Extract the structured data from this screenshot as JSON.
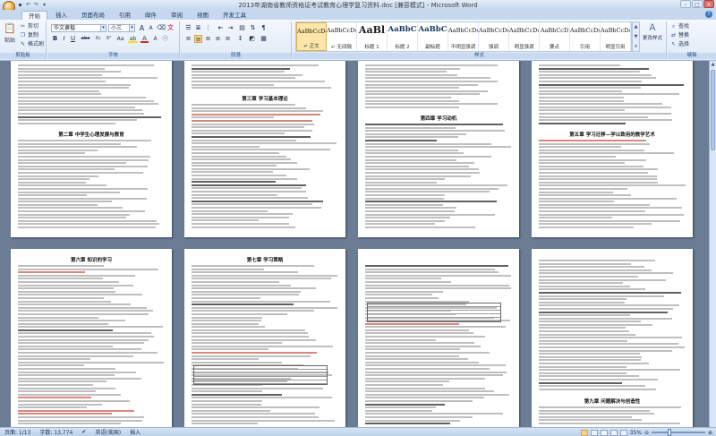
{
  "window": {
    "title": "2013年湖南省教师资格证考试教育心理学复习资料.doc [兼容模式] - Microsoft Word"
  },
  "quick_access": [
    "save-icon",
    "undo-icon",
    "redo-icon",
    "dropdown-icon"
  ],
  "tabs": [
    "开始",
    "插入",
    "页面布局",
    "引用",
    "邮件",
    "审阅",
    "视图",
    "开发工具"
  ],
  "active_tab_index": 0,
  "ribbon": {
    "clipboard": {
      "label": "剪贴板",
      "paste": "粘贴",
      "cut": "剪切",
      "copy": "复制",
      "format_painter": "格式刷"
    },
    "font": {
      "label": "字体",
      "font_name": "华文隶楷",
      "font_size": "小三",
      "grow": "A",
      "shrink": "A",
      "bold": "B",
      "italic": "I",
      "underline": "U",
      "strike": "abc",
      "subscript": "X₂",
      "superscript": "X²",
      "change_case": "Aa",
      "highlight": "ab",
      "font_color": "A"
    },
    "paragraph": {
      "label": "段落"
    },
    "styles": {
      "label": "样式",
      "items": [
        {
          "sample": "AaBbCcDc",
          "name": "↵ 正文",
          "kind": "normal"
        },
        {
          "sample": "AaBbCcDc",
          "name": "↵ 无间隔",
          "kind": "normal"
        },
        {
          "sample": "AaBl",
          "name": "标题 1",
          "kind": "big"
        },
        {
          "sample": "AaBbC",
          "name": "标题 2",
          "kind": "head"
        },
        {
          "sample": "AaBbC",
          "name": "副标题",
          "kind": "head"
        },
        {
          "sample": "AaBbCcDc",
          "name": "不明显强调",
          "kind": "normal"
        },
        {
          "sample": "AaBbCcDc",
          "name": "强调",
          "kind": "normal"
        },
        {
          "sample": "AaBbCcDc",
          "name": "明显强调",
          "kind": "normal"
        },
        {
          "sample": "AaBbCcD",
          "name": "要点",
          "kind": "normal"
        },
        {
          "sample": "AaBbCcDc",
          "name": "引用",
          "kind": "normal"
        },
        {
          "sample": "AaBbCcDc",
          "name": "明显引用",
          "kind": "normal"
        }
      ],
      "change_styles": "更改样式"
    },
    "editing": {
      "label": "编辑",
      "find": "查找",
      "replace": "替换",
      "select": "选择"
    }
  },
  "pages": [
    {
      "heading": "第二章 中学生心理发展与教育"
    },
    {
      "heading": "第三章 学习基本理论"
    },
    {
      "heading": "第四章 学习动机"
    },
    {
      "heading": "第五章 学习迁移—学以致用的教学艺术"
    },
    {
      "heading": "第六章 知识的学习"
    },
    {
      "heading": "第七章 学习策略"
    },
    {
      "heading": ""
    },
    {
      "heading": "第九章 问题解决与创造性"
    }
  ],
  "statusbar": {
    "page": "页面: 1/13",
    "words": "字数: 13,774",
    "language": "英语(美国)",
    "mode": "插入",
    "zoom": "35%"
  }
}
